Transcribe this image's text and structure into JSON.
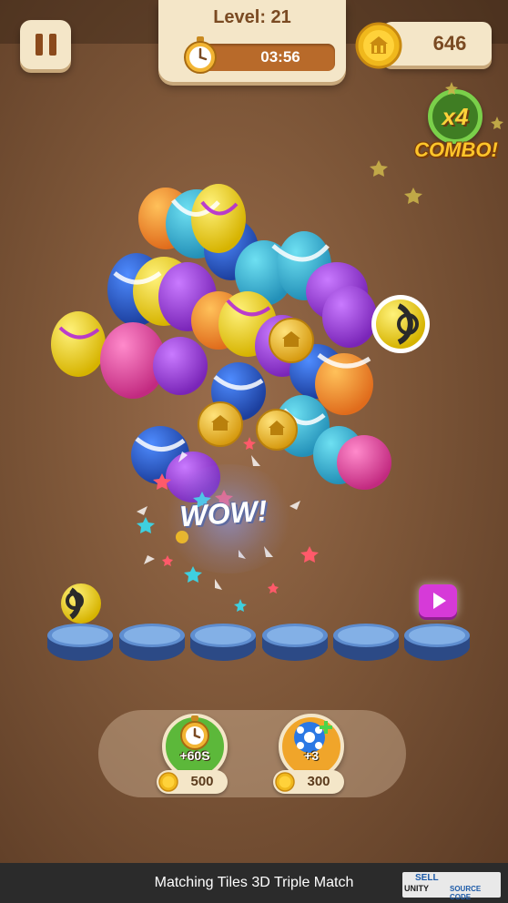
{
  "hud": {
    "level_label": "Level: 21",
    "timer": "03:56",
    "coins": "646",
    "combo_multiplier": "x4",
    "combo_label": "COMBO!",
    "pause_icon": "pause-icon",
    "stopwatch_icon": "stopwatch-icon",
    "coin_icon": "coin-icon"
  },
  "play_area": {
    "effect_text": "WOW!",
    "slots_total": 6,
    "slots_filled": 0,
    "waiting_ball": "yellow-black-ball",
    "ad_button_icon": "play-icon"
  },
  "boosters": [
    {
      "icon": "stopwatch-icon",
      "label": "+60S",
      "price": "500",
      "color": "#5cb83a"
    },
    {
      "icon": "soccer-ball-icon",
      "label": "+3",
      "price": "300",
      "color": "#f0a52a"
    }
  ],
  "footer": {
    "title": "Matching Tiles 3D Triple Match",
    "watermark_line1": "SELL",
    "watermark_line2": "UNITY",
    "watermark_line3": "SOURCE CODE"
  },
  "colors": {
    "panel": "#f4e6c8",
    "accent_brown": "#7a4a22",
    "timer_bar": "#b86a2a",
    "combo_green": "#7ad04a",
    "combo_gold": "#ffc52a",
    "ad_button": "#d63ad8"
  }
}
